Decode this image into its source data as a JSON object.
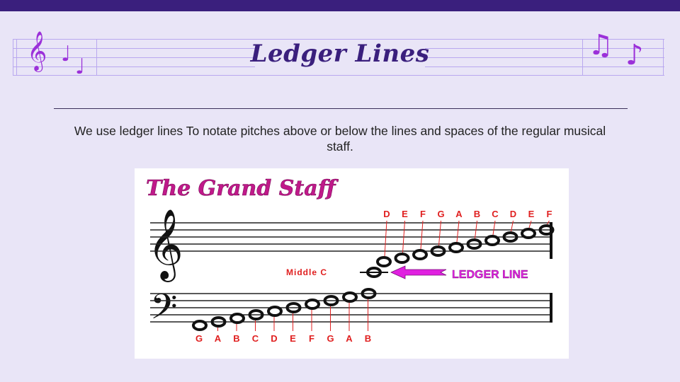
{
  "slide": {
    "title": "Ledger Lines",
    "description": "We use ledger lines To notate pitches above or below the lines and spaces of the regular musical staff."
  },
  "decoration": {
    "left_glyphs": [
      "𝄞",
      "♩",
      "♩"
    ],
    "right_glyphs": [
      "♫",
      "♪"
    ]
  },
  "figure": {
    "heading": "The Grand Staff",
    "middle_c_label": "Middle C",
    "ledger_label": "LEDGER LINE",
    "treble_notes": [
      "D",
      "E",
      "F",
      "G",
      "A",
      "B",
      "C",
      "D",
      "E",
      "F"
    ],
    "bass_notes": [
      "G",
      "A",
      "B",
      "C",
      "D",
      "E",
      "F",
      "G",
      "A",
      "B"
    ],
    "colors": {
      "labels": "#e02020",
      "ledger": "#e020e0",
      "heading": "#c0198a"
    }
  }
}
